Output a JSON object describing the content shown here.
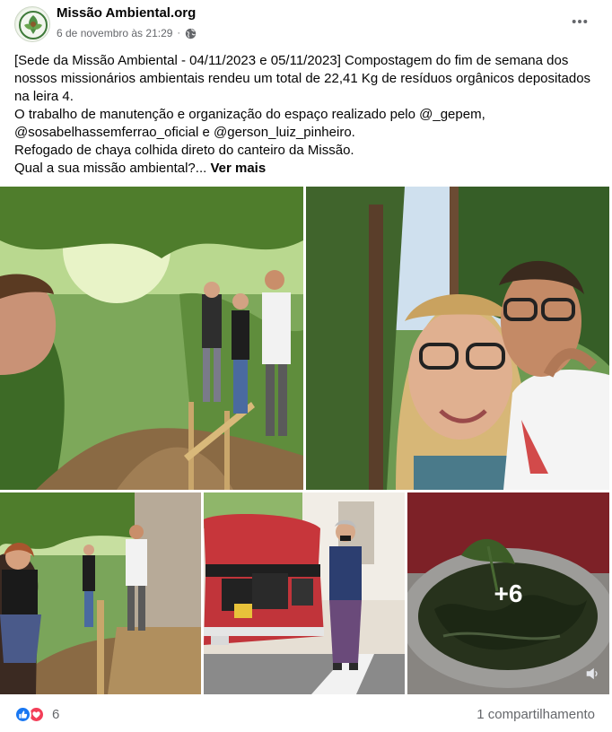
{
  "post": {
    "page_name": "Missão Ambiental.org",
    "timestamp": "6 de novembro às 21:29",
    "separator": "·",
    "privacy_icon": "globe-icon",
    "more_icon": "more-options-icon",
    "text_lines": [
      "[Sede da Missão Ambiental - 04/11/2023 e 05/11/2023] Compostagem do fim de semana dos nossos missionários ambientais rendeu um total de 22,41 Kg de resíduos orgânicos depositados na leira 4.",
      "O trabalho de manutenção e organização do espaço realizado pelo @_gepem, @sosabelhassemferrao_oficial e @gerson_luiz_pinheiro.",
      "Refogado de chaya colhida direto do canteiro da Missão."
    ],
    "last_line": "Qual a sua missão ambiental?...",
    "see_more": "Ver mais"
  },
  "photos": {
    "more_count": "+6"
  },
  "footer": {
    "reaction_icons": [
      "like-icon",
      "love-icon"
    ],
    "reaction_count": "6",
    "shares": "1 compartilhamento"
  },
  "colors": {
    "link_blue": "#1877f2",
    "love_red": "#f33e58",
    "secondary_text": "#65676b"
  }
}
